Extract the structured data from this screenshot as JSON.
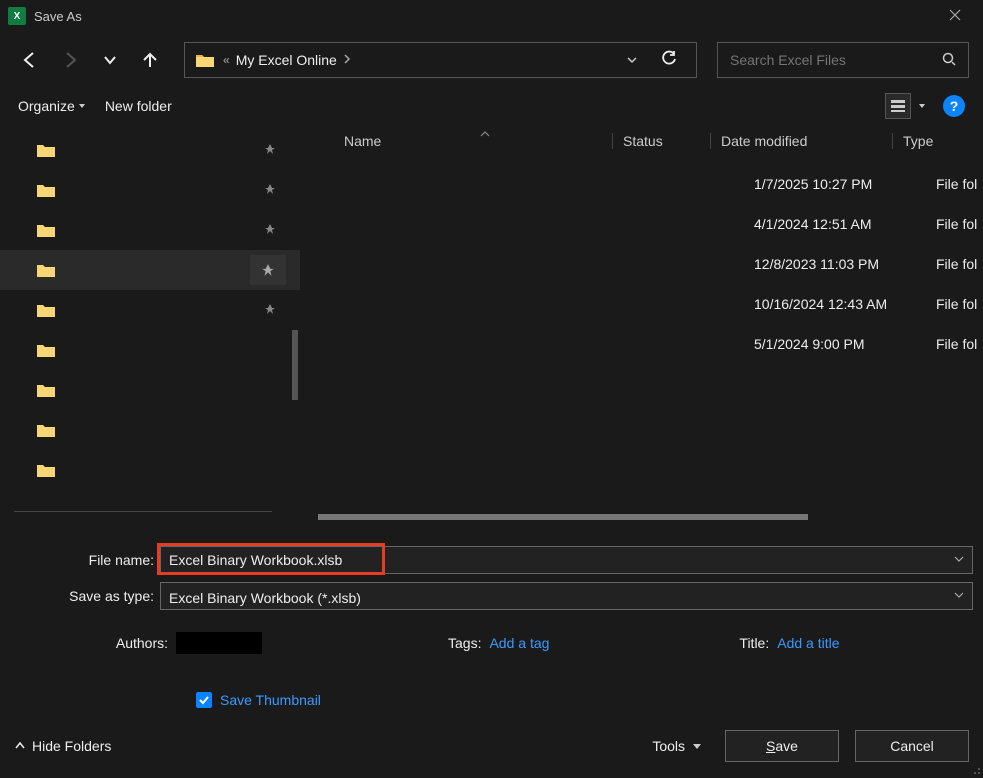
{
  "window": {
    "title": "Save As",
    "app_icon_letter": "X"
  },
  "nav": {
    "breadcrumb_prefix": "«",
    "breadcrumb": "My Excel Online",
    "search_placeholder": "Search Excel Files"
  },
  "toolbar": {
    "organize": "Organize",
    "new_folder": "New folder"
  },
  "columns": {
    "name": "Name",
    "status": "Status",
    "date": "Date modified",
    "type": "Type"
  },
  "rows": [
    {
      "date": "1/7/2025 10:27 PM",
      "type": "File fol"
    },
    {
      "date": "4/1/2024 12:51 AM",
      "type": "File fol"
    },
    {
      "date": "12/8/2023 11:03 PM",
      "type": "File fol"
    },
    {
      "date": "10/16/2024 12:43 AM",
      "type": "File fol"
    },
    {
      "date": "5/1/2024 9:00 PM",
      "type": "File fol"
    }
  ],
  "form": {
    "filename_label": "File name:",
    "filename_value": "Excel Binary Workbook.xlsb",
    "type_label": "Save as type:",
    "type_value": "Excel Binary Workbook (*.xlsb)",
    "authors_label": "Authors:",
    "tags_label": "Tags:",
    "tags_link": "Add a tag",
    "title_label": "Title:",
    "title_link": "Add a title",
    "thumbnail_label": "Save Thumbnail"
  },
  "footer": {
    "hide_folders": "Hide Folders",
    "tools": "Tools",
    "save": "Save",
    "cancel": "Cancel"
  }
}
